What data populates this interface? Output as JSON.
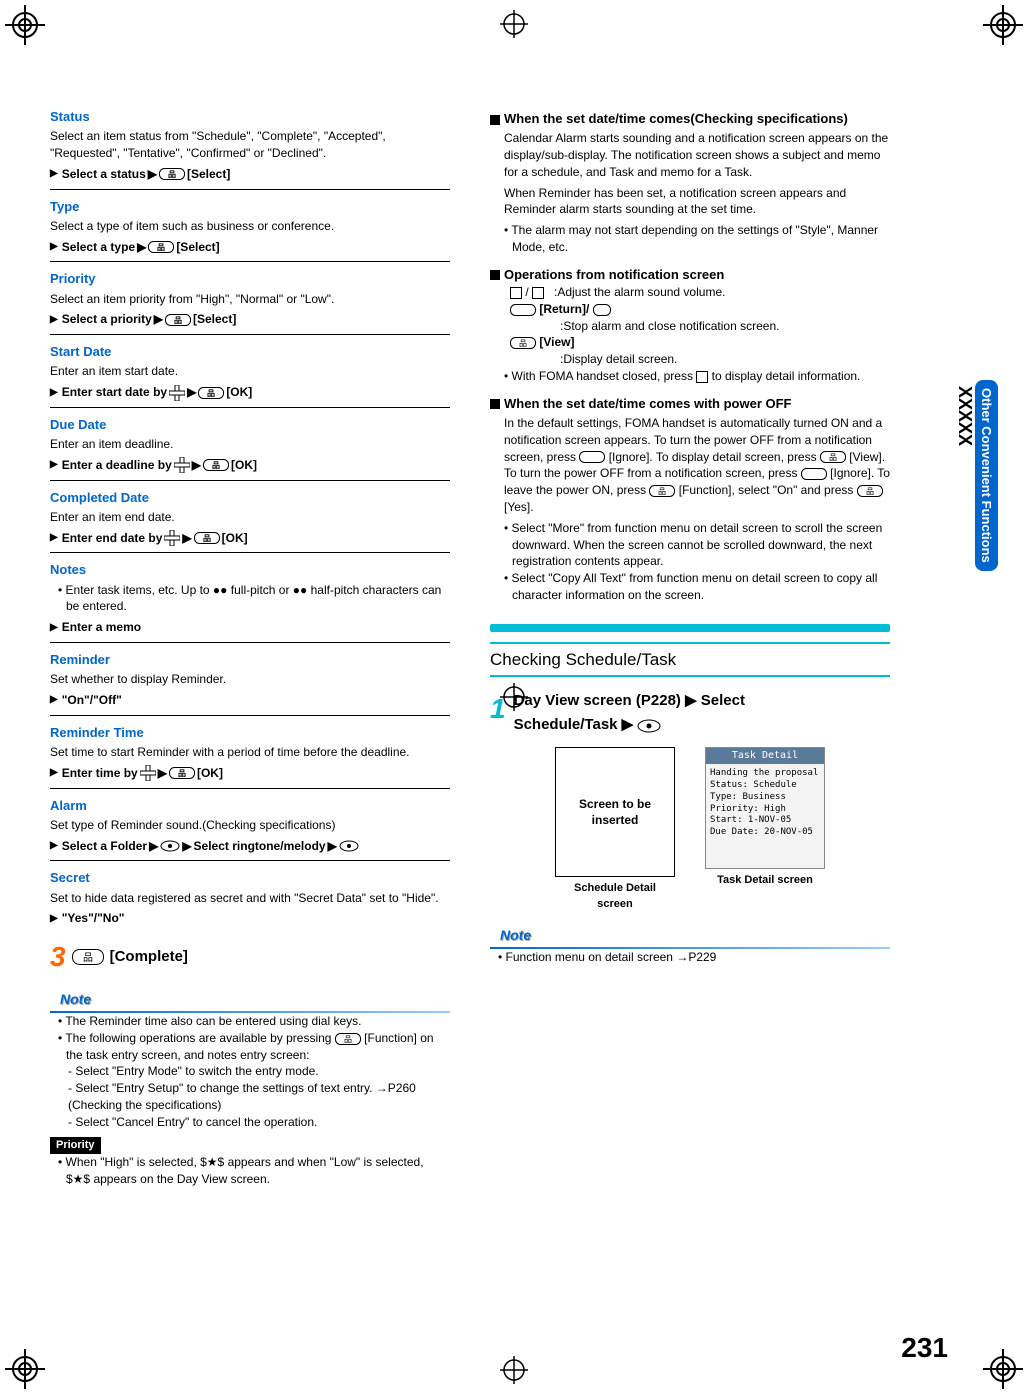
{
  "pageNumber": "231",
  "sideTab": {
    "label": "Other Convenient Functions",
    "code": "XXXXX"
  },
  "left": {
    "status": {
      "title": "Status",
      "desc": "Select an item status from \"Schedule\", \"Complete\", \"Accepted\", \"Requested\", \"Tentative\", \"Confirmed\" or \"Declined\".",
      "action": "Select a status",
      "btn": "[Select]"
    },
    "type": {
      "title": "Type",
      "desc": "Select a type of item such as business or conference.",
      "action": "Select a type",
      "btn": "[Select]"
    },
    "priority": {
      "title": "Priority",
      "desc": "Select an item priority from \"High\", \"Normal\" or \"Low\".",
      "action": "Select a priority",
      "btn": "[Select]"
    },
    "startDate": {
      "title": "Start Date",
      "desc": "Enter an item start date.",
      "action": "Enter start date by",
      "btn": "[OK]"
    },
    "dueDate": {
      "title": "Due Date",
      "desc": "Enter an item deadline.",
      "action": "Enter a deadline by",
      "btn": "[OK]"
    },
    "completedDate": {
      "title": "Completed Date",
      "desc": "Enter an item end date.",
      "action": "Enter end date by",
      "btn": "[OK]"
    },
    "notes": {
      "title": "Notes",
      "desc": "Enter task items, etc. Up to ●● full-pitch or ●● half-pitch characters can be entered.",
      "action": "Enter a memo"
    },
    "reminder": {
      "title": "Reminder",
      "desc": "Set whether to display Reminder.",
      "action": "\"On\"/\"Off\""
    },
    "reminderTime": {
      "title": "Reminder Time",
      "desc": "Set time to start Reminder with a period of time before the deadline.",
      "action": "Enter time by",
      "btn": "[OK]"
    },
    "alarm": {
      "title": "Alarm",
      "desc": "Set type of Reminder sound.(Checking specifications)",
      "action1": "Select a Folder",
      "action2": "Select ringtone/melody"
    },
    "secret": {
      "title": "Secret",
      "desc": "Set to hide data registered as secret and with \"Secret Data\" set to \"Hide\".",
      "action": "\"Yes\"/\"No\""
    },
    "step3": {
      "num": "3",
      "label": "[Complete]"
    },
    "noteHdr": "Note",
    "noteItems": [
      "The Reminder time also can be entered using dial keys.",
      "The following operations are available by pressing",
      "[Function] on the task entry screen, and notes entry screen:",
      "Select \"Entry Mode\" to switch the entry mode.",
      "Select \"Entry Setup\" to change the settings of text entry. →P260 (Checking the specifications)",
      "Select \"Cancel Entry\" to cancel the operation."
    ],
    "priorityTag": "Priority",
    "priorityNote": "When \"High\" is selected, $★$ appears and when \"Low\" is selected, $★$ appears on the Day View screen."
  },
  "right": {
    "h1": {
      "title": "When the set date/time comes(Checking specifications)",
      "p1": "Calendar Alarm starts sounding and a notification screen appears on the display/sub-display. The notification screen shows a subject and memo for a schedule, and Task and memo for a Task.",
      "p2": "When Reminder has been set, a notification screen appears and Reminder alarm starts sounding at the set time.",
      "b1": "The alarm may not start depending on the settings of \"Style\", Manner Mode, etc."
    },
    "h2": {
      "title": "Operations from notification screen",
      "l1": ":Adjust the alarm sound volume.",
      "l2a": "[Return]/",
      "l2b": ":Stop alarm and close notification screen.",
      "l3a": "[View]",
      "l3b": ":Display detail screen.",
      "b1": "With FOMA handset closed, press",
      "b1b": "to display detail information."
    },
    "h3": {
      "title": "When the set date/time comes with power OFF",
      "p1": "In the default settings, FOMA handset is automatically turned ON and a notification screen appears. To turn the power OFF from a notification screen, press",
      "p1b": "[Ignore]. To display detail screen, press",
      "p1c": "[View]. To turn the power OFF from a notification screen, press",
      "p1d": "[Ignore]. To leave the power ON, press",
      "p1e": "[Function], select \"On\" and press",
      "p1f": "[Yes].",
      "b1": "Select \"More\" from function menu on detail screen to scroll the screen downward. When the screen cannot be scrolled downward, the next registration contents appear.",
      "b2": "Select \"Copy All Text\" from function menu on detail screen to copy all character information on the screen."
    },
    "checkTitle": "Checking Schedule/Task",
    "step1": {
      "num": "1",
      "l1": "Day View screen (P228)",
      "l2": "Select",
      "l3": "Schedule/Task"
    },
    "screen1": {
      "placeholder": "Screen to be inserted",
      "caption": "Schedule Detail screen"
    },
    "screen2": {
      "hdr": "Task Detail",
      "lines": [
        "Handing the proposal",
        "Status: Schedule",
        "Type: Business",
        "Priority: High",
        "Start: 1-NOV-05",
        "Due Date: 20-NOV-05"
      ],
      "caption": "Task Detail screen"
    },
    "noteHdr": "Note",
    "noteItem": "Function menu on detail screen →P229"
  }
}
